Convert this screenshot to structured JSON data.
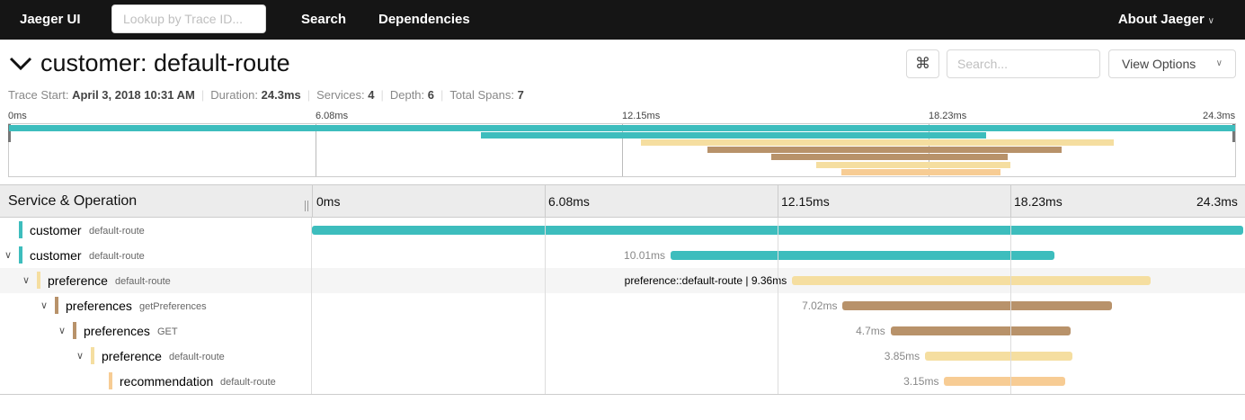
{
  "nav": {
    "brand": "Jaeger UI",
    "lookup_placeholder": "Lookup by Trace ID...",
    "search": "Search",
    "dependencies": "Dependencies",
    "about": "About Jaeger"
  },
  "header": {
    "title": "customer: default-route",
    "kbd_icon": "⌘",
    "search_placeholder": "Search...",
    "view_options": "View Options"
  },
  "meta": {
    "trace_start_label": "Trace Start:",
    "trace_start": "April 3, 2018 10:31 AM",
    "duration_label": "Duration:",
    "duration": "24.3ms",
    "services_label": "Services:",
    "services": "4",
    "depth_label": "Depth:",
    "depth": "6",
    "total_spans_label": "Total Spans:",
    "total_spans": "7"
  },
  "ticks": [
    "0ms",
    "6.08ms",
    "12.15ms",
    "18.23ms",
    "24.3ms"
  ],
  "timeline": {
    "column_title": "Service & Operation"
  },
  "colors": {
    "customer": "#3dbdbd",
    "preference": "#f5dea0",
    "preferences": "#b8926a",
    "recommendation": "#f7cc94"
  },
  "spans": [
    {
      "service": "customer",
      "operation": "default-route",
      "depth": 0,
      "toggle": "",
      "start_ms": 0.0,
      "duration_ms": 24.3,
      "label": ""
    },
    {
      "service": "customer",
      "operation": "default-route",
      "depth": 0,
      "toggle": "⌄",
      "start_ms": 9.36,
      "duration_ms": 10.01,
      "label": "10.01ms"
    },
    {
      "service": "preference",
      "operation": "default-route",
      "depth": 1,
      "toggle": "⌄",
      "start_ms": 12.53,
      "duration_ms": 9.36,
      "label": "preference::default-route | 9.36ms"
    },
    {
      "service": "preferences",
      "operation": "getPreferences",
      "depth": 2,
      "toggle": "⌄",
      "start_ms": 13.85,
      "duration_ms": 7.02,
      "label": "7.02ms"
    },
    {
      "service": "preferences",
      "operation": "GET",
      "depth": 3,
      "toggle": "⌄",
      "start_ms": 15.1,
      "duration_ms": 4.7,
      "label": "4.7ms"
    },
    {
      "service": "preference",
      "operation": "default-route",
      "depth": 4,
      "toggle": "⌄",
      "start_ms": 16.0,
      "duration_ms": 3.85,
      "label": "3.85ms"
    },
    {
      "service": "recommendation",
      "operation": "default-route",
      "depth": 5,
      "toggle": "",
      "start_ms": 16.5,
      "duration_ms": 3.15,
      "label": "3.15ms"
    }
  ]
}
